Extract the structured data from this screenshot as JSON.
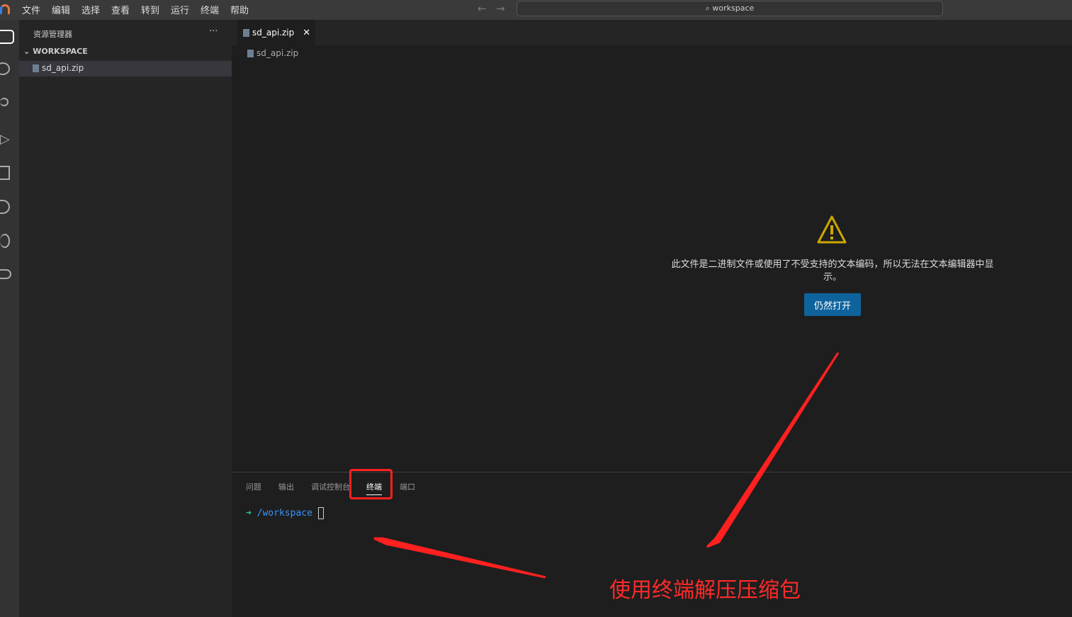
{
  "menu": [
    "文件",
    "编辑",
    "选择",
    "查看",
    "转到",
    "运行",
    "终端",
    "帮助"
  ],
  "search": {
    "label": "workspace"
  },
  "sidebar": {
    "title": "资源管理器",
    "more": "···",
    "section": "WORKSPACE",
    "files": [
      "sd_api.zip"
    ]
  },
  "editor": {
    "tab": "sd_api.zip",
    "breadcrumb": "sd_api.zip",
    "message": "此文件是二进制文件或使用了不受支持的文本编码，所以无法在文本编辑器中显示。",
    "open_anyway": "仍然打开"
  },
  "panel": {
    "tabs": [
      "问题",
      "输出",
      "调试控制台",
      "终端",
      "端口"
    ],
    "active_tab": "终端",
    "prompt_arrow": "➜",
    "cwd": "/workspace"
  },
  "annotation": {
    "text": "使用终端解压压缩包",
    "color": "#ff2a2a"
  },
  "colors": {
    "accent": "#0e639c",
    "warning": "#cca700",
    "prompt": "#23d18b",
    "path": "#3794ff"
  }
}
